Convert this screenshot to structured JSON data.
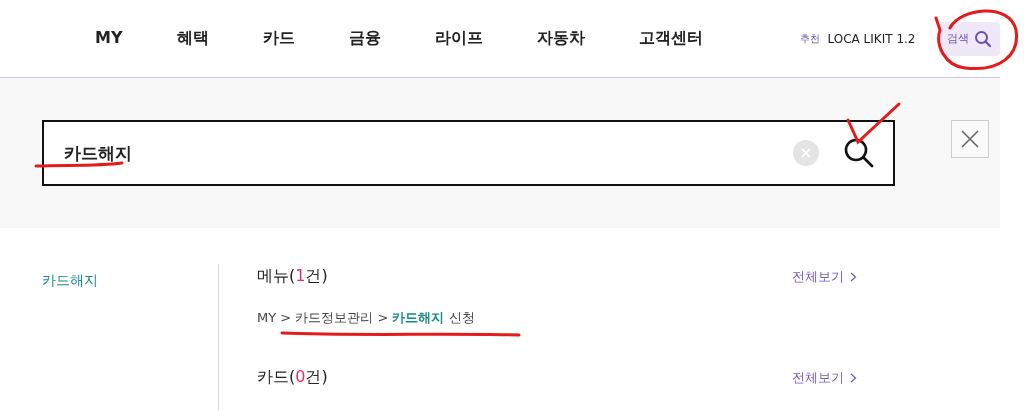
{
  "nav": {
    "items": [
      {
        "label": "MY"
      },
      {
        "label": "혜택"
      },
      {
        "label": "카드"
      },
      {
        "label": "금융"
      },
      {
        "label": "라이프"
      },
      {
        "label": "자동차"
      },
      {
        "label": "고객센터"
      }
    ],
    "recommend_tag": "추천",
    "recommend_text": "LOCA LIKIT 1.2",
    "search_button": "검색"
  },
  "search": {
    "value": "카드해지"
  },
  "sidebar": {
    "items": [
      {
        "label": "카드해지",
        "selected": true
      }
    ]
  },
  "sections": [
    {
      "prefix": "메뉴(",
      "count": "1",
      "suffix": "건)",
      "more": "전체보기",
      "results": [
        {
          "parts": [
            {
              "text": "MY > 카드정보관리 > ",
              "highlight": false
            },
            {
              "text": "카드해지",
              "highlight": true
            },
            {
              "text": " 신청",
              "highlight": false
            }
          ]
        }
      ]
    },
    {
      "prefix": "카드(",
      "count": "0",
      "suffix": "건)",
      "more": "전체보기"
    }
  ]
}
